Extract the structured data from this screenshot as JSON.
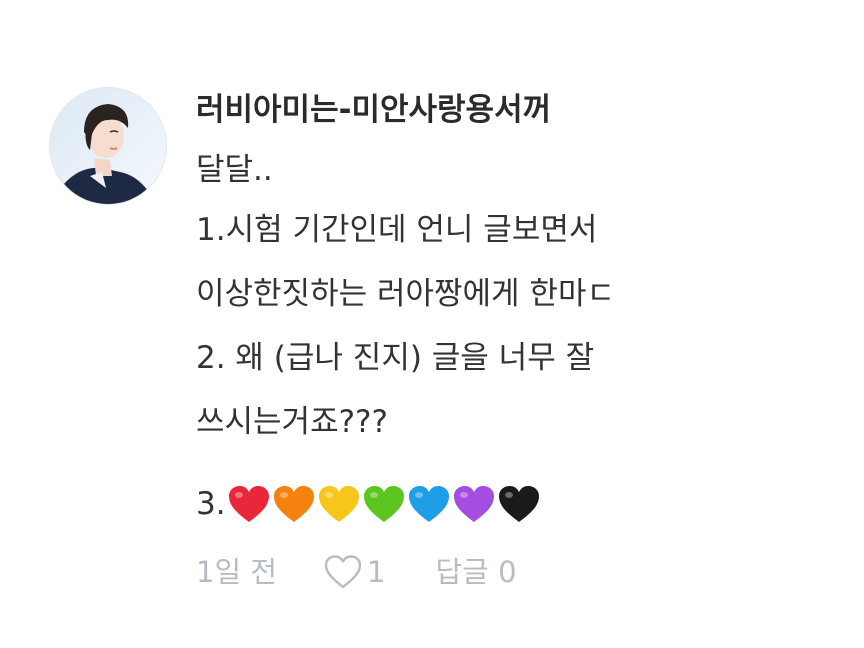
{
  "comment": {
    "username": "러비아미는-미안사랑용서꺼",
    "lines": [
      "달달..",
      "1.시험 기간인데 언니 글보면서",
      "이상한짓하는 러아짱에게 한마ㄷ",
      "2. 왜 (급나 진지) 글을 너무 잘",
      "쓰시는거죠???"
    ],
    "hearts_prefix": "3.",
    "hearts": [
      {
        "icon": "red-heart-icon",
        "color": "#e8283a"
      },
      {
        "icon": "orange-heart-icon",
        "color": "#f5820e"
      },
      {
        "icon": "yellow-heart-icon",
        "color": "#f7c61b"
      },
      {
        "icon": "green-heart-icon",
        "color": "#5cc51f"
      },
      {
        "icon": "blue-heart-icon",
        "color": "#1f9ee8"
      },
      {
        "icon": "purple-heart-icon",
        "color": "#a34ee0"
      },
      {
        "icon": "black-heart-icon",
        "color": "#1a1a1a"
      }
    ],
    "meta": {
      "time": "1일 전",
      "like_count": "1",
      "reply_label": "답글 0"
    },
    "colors": {
      "meta_gray": "#b6bcc4",
      "text": "#333333"
    }
  }
}
